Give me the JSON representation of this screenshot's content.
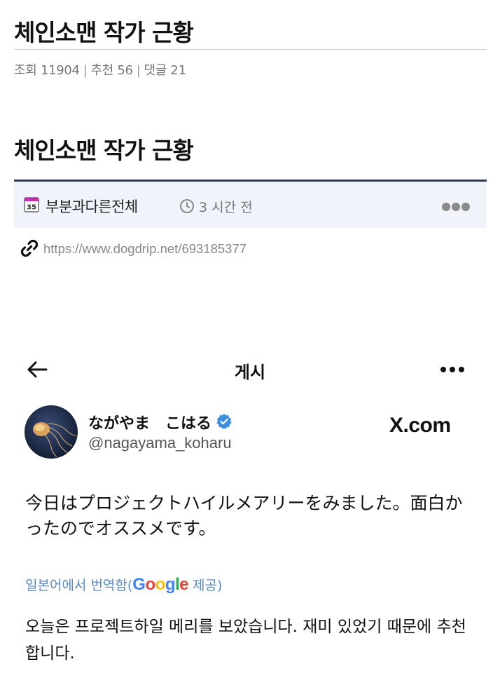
{
  "post": {
    "title": "체인소맨 작가 근황",
    "meta": {
      "views": "조회 11904",
      "sep": "|",
      "recommends": "추천 56",
      "comments": "댓글 21"
    }
  },
  "content": {
    "title": "체인소맨 작가 근황",
    "info_bar": {
      "category_icon": "calendar-icon",
      "calendar_number": "35",
      "category": "부분과다른전체",
      "time_ago": "3 시간 전"
    },
    "source_url": "https://www.dogdrip.net/693185377"
  },
  "embedded": {
    "screen_title": "게시",
    "user": {
      "display_name": "ながやま　こはる",
      "handle": "@nagayama_koharu"
    },
    "brand": "X.com",
    "tweet_text": "今日はプロジェクトハイルメアリーをみました。面白かったのでオススメです。",
    "translated_by": {
      "prefix": "일본어에서 번역함(",
      "google": [
        "G",
        "o",
        "o",
        "g",
        "l",
        "e"
      ],
      "suffix": " 제공)"
    },
    "translation": "오늘은 프로젝트하일 메리를 보았습니다. 재미 있었기 때문에 추천합니다."
  },
  "colors": {
    "accent_bar": "#333a4e",
    "info_bg": "#f1f3fb",
    "verified": "#3b8de0",
    "translate_link": "#5a8ac6",
    "google": [
      "#4285F4",
      "#EA4335",
      "#FBBC05",
      "#4285F4",
      "#34A853",
      "#EA4335"
    ]
  }
}
